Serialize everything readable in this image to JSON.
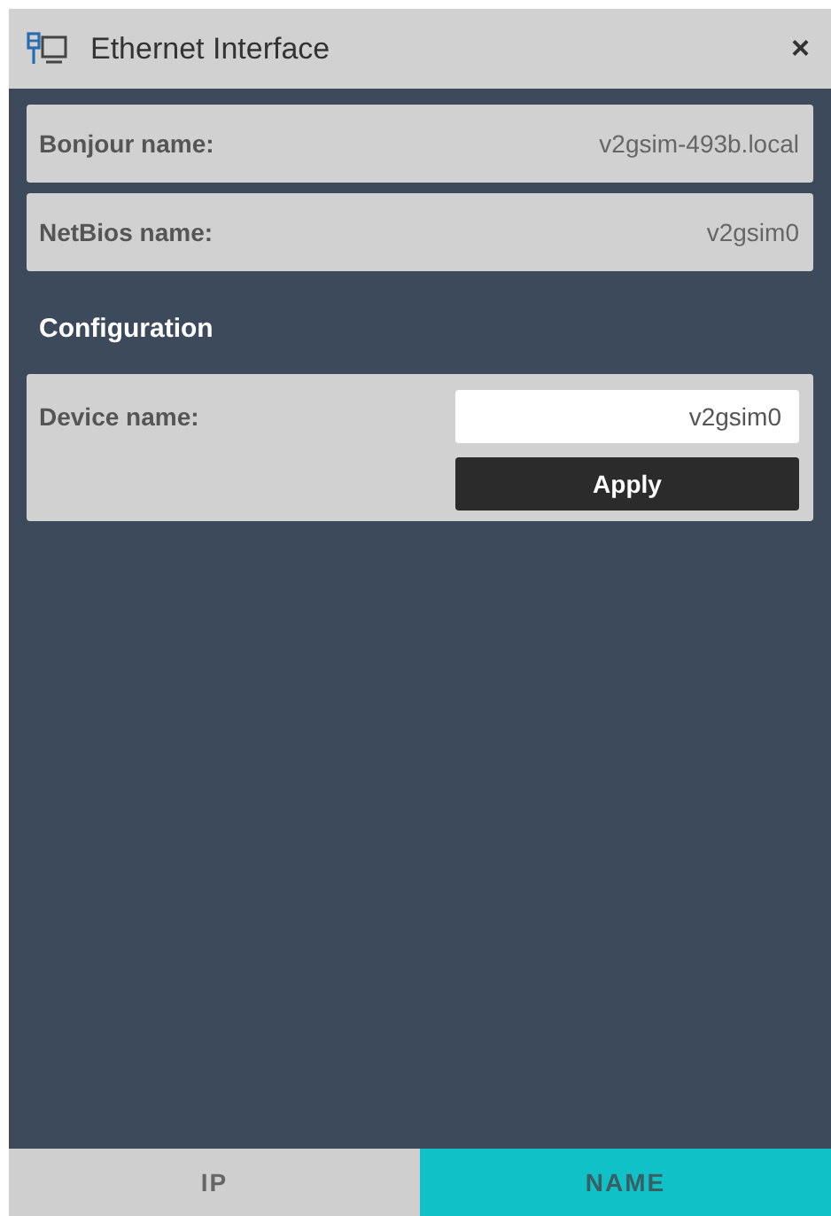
{
  "window": {
    "title": "Ethernet Interface",
    "close": "×"
  },
  "info_rows": [
    {
      "label": "Bonjour name:",
      "value": "v2gsim-493b.local"
    },
    {
      "label": "NetBios name:",
      "value": "v2gsim0"
    }
  ],
  "configuration": {
    "heading": "Configuration",
    "label": "Device name:",
    "value": "v2gsim0",
    "button": "Apply"
  },
  "tabs": [
    {
      "label": "IP",
      "selected": false
    },
    {
      "label": "NAME",
      "selected": true
    }
  ]
}
